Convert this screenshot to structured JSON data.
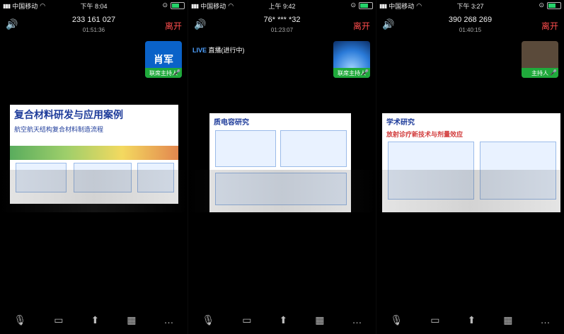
{
  "status": {
    "carrier": "中国移动",
    "panels_time": [
      "下午 8:04",
      "上午 9:42",
      "下午 3:27"
    ],
    "battery_levels": [
      0.6,
      0.7,
      0.65
    ]
  },
  "meetings": [
    {
      "id": "233 161 027",
      "duration": "01:51:36",
      "leave": "离开",
      "avatar_label": "肖军",
      "host_label": "联席主持人",
      "slide_title": "复合材料研发与应用案例",
      "slide_sub": "航空航天结构复合材料制造流程"
    },
    {
      "id": "76* *** *32",
      "duration": "01:23:07",
      "leave": "离开",
      "live_badge": "LIVE",
      "live_text": "直播(进行中)",
      "host_label": "联席主持人",
      "slide_title": "质电容研究"
    },
    {
      "id": "390 268 269",
      "duration": "01:40:15",
      "leave": "离开",
      "host_label": "主持人",
      "slide_title": "学术研究",
      "slide_sub": "放射诊疗新技术与剂量效应"
    }
  ],
  "toolbar": {
    "labels": [
      "",
      "",
      "",
      "",
      ""
    ]
  },
  "colors": {
    "leave": "#ff4d4d",
    "host": "#1faa3b",
    "live": "#4ea1ff"
  }
}
